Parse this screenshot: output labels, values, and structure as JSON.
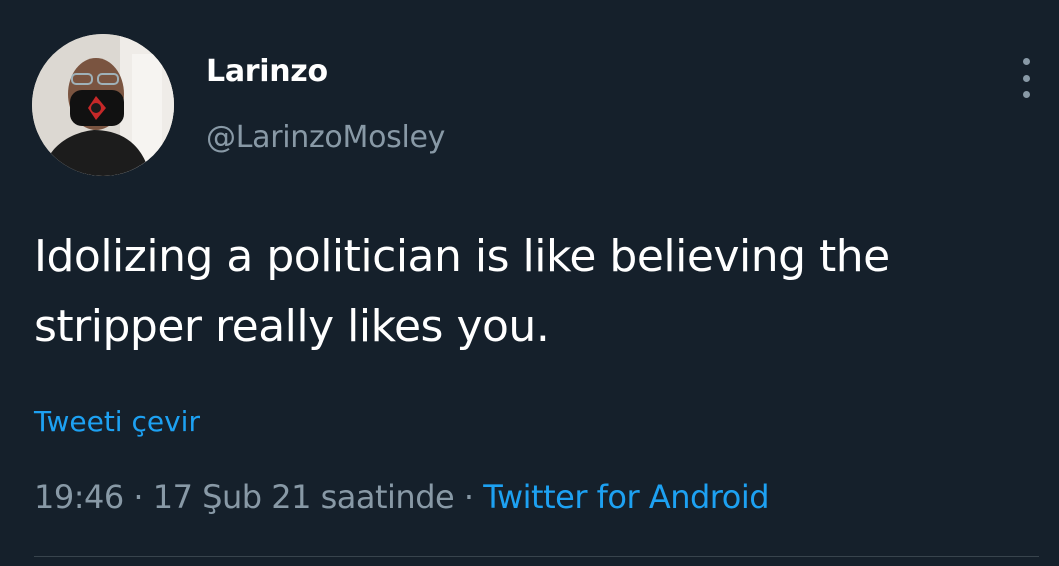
{
  "author": {
    "display_name": "Larinzo",
    "handle": "@LarinzoMosley",
    "avatar_icon": "profile-photo"
  },
  "tweet": {
    "text": "Idolizing a politician is like believing the stripper really likes you.",
    "translate_label": "Tweeti çevir"
  },
  "meta": {
    "time": "19:46",
    "separator": " · ",
    "date": "17 Şub 21 saatinde",
    "source": "Twitter for Android"
  },
  "colors": {
    "background": "#15202b",
    "accent": "#1da1f2",
    "secondary_text": "#8899a6"
  }
}
